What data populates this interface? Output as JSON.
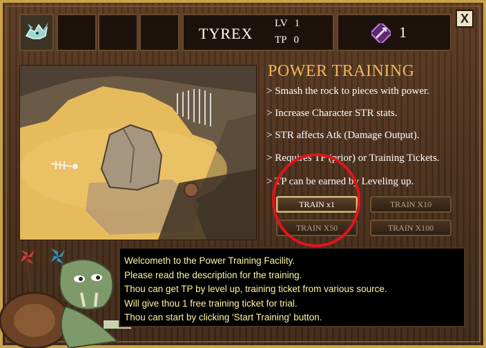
{
  "header": {
    "player_name": "TYREX",
    "lv_label": "LV",
    "lv_value": "1",
    "tp_label": "TP",
    "tp_value": "0",
    "ticket_count": "1",
    "close_label": "X"
  },
  "training": {
    "title": "POWER TRAINING",
    "descriptions": [
      "> Smash the rock to pieces with power.",
      "> Increase Character STR stats.",
      "> STR affects Atk (Damage Output).",
      "> Requires TP (prior) or Training Tickets.",
      "> TP can be earned by Leveling up."
    ],
    "buttons": {
      "train_x1": "TRAIN x1",
      "train_x10": "TRAIN X10",
      "train_x50": "TRAIN X50",
      "train_x100": "TRAIN X100"
    }
  },
  "dialog": {
    "lines": [
      "Welcometh to the Power Training Facility.",
      "Please read the description for the training.",
      "Thou can get TP by level up, training ticket from various source.",
      "Will give thou 1 free training ticket for trial.",
      "Thou can start by clicking 'Start Training' button."
    ]
  },
  "colors": {
    "title": "#f0b75a",
    "dialog_text": "#fff4a0",
    "frame_gold": "#c9a24a",
    "highlight_circle": "#e2141a"
  },
  "icons": {
    "portrait": "dragon-portrait-icon",
    "ticket": "training-ticket-icon",
    "close": "close-icon"
  }
}
